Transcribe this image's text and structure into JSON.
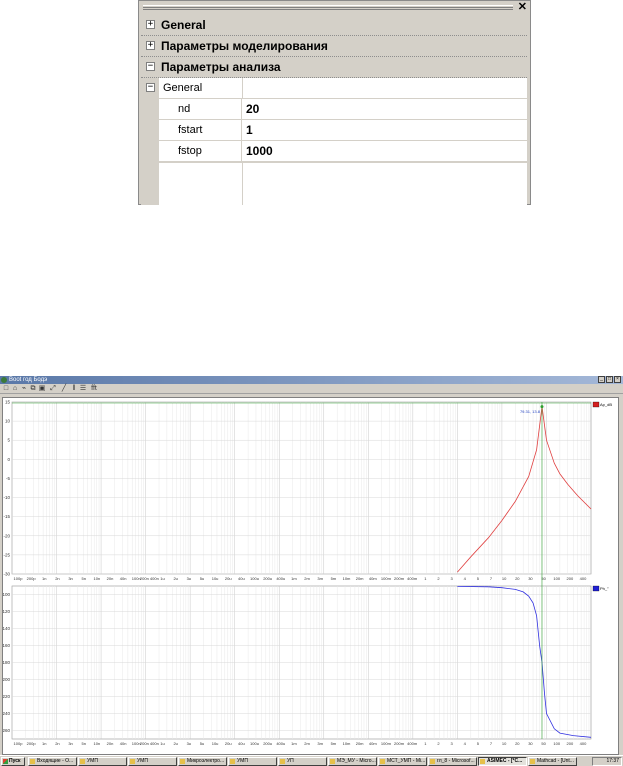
{
  "property_grid": {
    "categories": [
      {
        "label": "General",
        "state": "collapsed"
      },
      {
        "label": "Параметры моделирования",
        "state": "collapsed"
      },
      {
        "label": "Параметры анализа",
        "state": "expanded"
      }
    ],
    "subcategory": {
      "label": "General",
      "state": "expanded"
    },
    "properties": [
      {
        "name": "nd",
        "value": "20"
      },
      {
        "name": "fstart",
        "value": "1"
      },
      {
        "name": "fstop",
        "value": "1000"
      }
    ],
    "close_glyph": "✕"
  },
  "app": {
    "title": "Boot год Бодэ",
    "toolbar_icons": [
      "new-icon",
      "open-icon",
      "chart-icon",
      "copy-icon",
      "image-icon",
      "zoom-icon",
      "line-icon",
      "bars-icon",
      "grid-icon",
      "fft-icon"
    ],
    "toolbar_last_label": "fft"
  },
  "chart_data": [
    {
      "type": "line",
      "title": "",
      "x_scale": "log",
      "xlim": [
        1e-10,
        1000
      ],
      "ylim": [
        -30,
        15
      ],
      "yticks": [
        15,
        10,
        5,
        0,
        -5,
        -10,
        -15,
        -20,
        -25,
        -30
      ],
      "xtick_labels": [
        "100p",
        "200p",
        "1n",
        "2n",
        "3n",
        "5n",
        "10n",
        "20n",
        "40n",
        "100n",
        "200n 400n",
        "1u",
        "2u",
        "3u",
        "5u",
        "10u",
        "20u",
        "40u",
        "100u",
        "200u",
        "400u",
        "1m",
        "2m",
        "3m",
        "5m",
        "10m",
        "20m",
        "40m",
        "100m",
        "200m",
        "400m",
        "1",
        "2",
        "3",
        "4",
        "5",
        "7",
        "10",
        "20",
        "30",
        "50",
        "100",
        "200",
        "400"
      ],
      "legend": {
        "label": "Ap_dB",
        "color": "#d42020",
        "placement": "top-right"
      },
      "marker_label": "79.31, 13.8",
      "series": [
        {
          "name": "Ap_dB",
          "color": "#e04040",
          "x": [
            1,
            2,
            5,
            10,
            20,
            40,
            60,
            79.31,
            100,
            150,
            200,
            300,
            500,
            1000
          ],
          "y": [
            -29.5,
            -25.5,
            -20.5,
            -16,
            -11,
            -4.5,
            2.5,
            13.8,
            5,
            -1,
            -3.8,
            -6.5,
            -9.5,
            -13
          ]
        }
      ]
    },
    {
      "type": "line",
      "title": "",
      "x_scale": "log",
      "xlim": [
        1e-10,
        1000
      ],
      "ylim": [
        -270,
        -90
      ],
      "yticks": [
        -100,
        -120,
        -140,
        -160,
        -180,
        -200,
        -220,
        -240,
        -260
      ],
      "xtick_labels": [
        "100p",
        "200p",
        "1n",
        "2n",
        "3n",
        "5n",
        "10n",
        "20n",
        "40n",
        "100n",
        "200n 400n",
        "1u",
        "2u",
        "3u",
        "5u",
        "10u",
        "20u",
        "40u",
        "100u",
        "200u",
        "400u",
        "1m",
        "2m",
        "3m",
        "5m",
        "10m",
        "20m",
        "40m",
        "100m",
        "200m",
        "400m",
        "1",
        "2",
        "3",
        "4",
        "5",
        "7",
        "10",
        "20",
        "30",
        "50",
        "100",
        "200",
        "400"
      ],
      "legend": {
        "label": "Ph_°",
        "color": "#2020d4",
        "placement": "top-right"
      },
      "series": [
        {
          "name": "Ph_°",
          "color": "#3030e0",
          "x": [
            1,
            5,
            10,
            20,
            30,
            40,
            50,
            60,
            70,
            79.31,
            90,
            100,
            150,
            200,
            400,
            1000
          ],
          "y": [
            -90.5,
            -91,
            -92,
            -94,
            -97,
            -102,
            -110,
            -125,
            -160,
            -180,
            -215,
            -240,
            -258,
            -263,
            -266,
            -268
          ]
        }
      ]
    }
  ],
  "taskbar": {
    "start_label": "Пуск",
    "tasks": [
      {
        "label": "Входящие - O...",
        "active": false
      },
      {
        "label": "УМП",
        "active": false
      },
      {
        "label": "УМП",
        "active": false
      },
      {
        "label": "Микроэлектро...",
        "active": false
      },
      {
        "label": "УМП",
        "active": false
      },
      {
        "label": "УП",
        "active": false
      },
      {
        "label": "МЭ_МУ - Micro...",
        "active": false
      },
      {
        "label": "МСТ_УМП - Mi...",
        "active": false
      },
      {
        "label": "гл_8 - Microsof...",
        "active": false
      },
      {
        "label": "ASIMEC - [*C...",
        "active": true
      },
      {
        "label": "Mathcad - [Unt...",
        "active": false
      }
    ],
    "clock": "17:37"
  }
}
